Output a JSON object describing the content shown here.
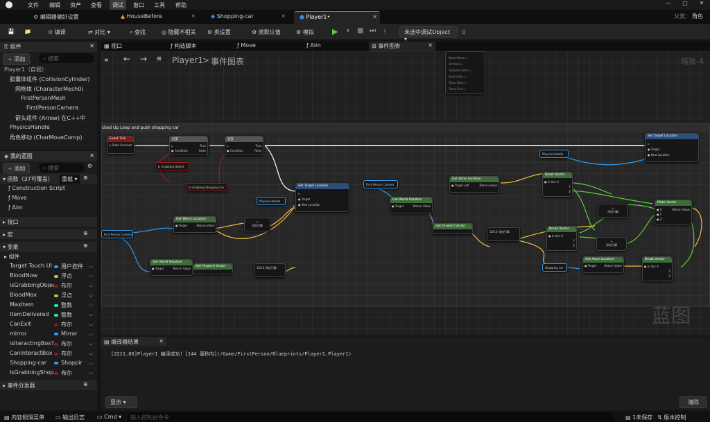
{
  "menu": [
    "文件",
    "编辑",
    "资产",
    "查看",
    "调试",
    "窗口",
    "工具",
    "帮助"
  ],
  "tabs": [
    {
      "label": "编辑器偏好设置",
      "active": false
    },
    {
      "label": "HouseBefore",
      "active": false
    },
    {
      "label": "Shopping-car",
      "active": false
    },
    {
      "label": "Player1•",
      "active": true
    }
  ],
  "parent": {
    "label": "父类：",
    "value": "角色"
  },
  "toolbar": {
    "compile": "编译",
    "diff": "对比",
    "find": "查找",
    "hide": "隐藏不相关",
    "class_settings": "类设置",
    "class_defaults": "类默认值",
    "simulate": "模拟",
    "debug_object": "未选中调试Object"
  },
  "components": {
    "title": "组件",
    "add": "添加",
    "search_placeholder": "搜索",
    "items": [
      {
        "label": "Player1（自我）",
        "indent": 0
      },
      {
        "label": "胶囊体组件 (CollisionCylinder)",
        "indent": 1
      },
      {
        "label": "网格体 (CharacterMesh0)",
        "indent": 2
      },
      {
        "label": "FirstPersonMesh",
        "indent": 3
      },
      {
        "label": "FirstPersonCamera",
        "indent": 4
      },
      {
        "label": "箭头组件 (Arrow)  在C++中",
        "indent": 2
      },
      {
        "label": "PhysicsHandle",
        "indent": 1
      },
      {
        "label": "角色移动 (CharMoveComp)",
        "indent": 1
      }
    ]
  },
  "mybp": {
    "title": "我的蓝图",
    "add": "添加",
    "search_placeholder": "搜索",
    "functions_label": "函数（37可覆盖）",
    "override": "重载",
    "functions": [
      "Construction Script",
      "Move",
      "Aim"
    ],
    "interfaces": "接口",
    "macros": "宏",
    "variables": "变量",
    "components": "组件",
    "dispatchers": "事件分发器",
    "vars": [
      {
        "name": "Target Touch UI",
        "type": "用户控件",
        "color": "#2d9bf0"
      },
      {
        "name": "BloodNow",
        "type": "浮点",
        "color": "#9ecf3c"
      },
      {
        "name": "isGrabbingObject",
        "type": "布尔",
        "color": "#8f1a1a"
      },
      {
        "name": "BloodMax",
        "type": "浮点",
        "color": "#9ecf3c"
      },
      {
        "name": "MaxItem",
        "type": "整数",
        "color": "#2de0b0"
      },
      {
        "name": "ItemDelivered",
        "type": "整数",
        "color": "#2de0b0"
      },
      {
        "name": "CanExit",
        "type": "布尔",
        "color": "#8f1a1a"
      },
      {
        "name": "mirror",
        "type": "Mirror",
        "color": "#2d9bf0"
      },
      {
        "name": "isIteractingBox?",
        "type": "布尔",
        "color": "#8f1a1a"
      },
      {
        "name": "CanInteractBox",
        "type": "布尔",
        "color": "#8f1a1a"
      },
      {
        "name": "Shopping-car",
        "type": "Shoppir",
        "color": "#2d9bf0"
      },
      {
        "name": "IsGrabbingShopp",
        "type": "布尔",
        "color": "#8f1a1a"
      }
    ]
  },
  "editor_tabs": [
    "视口",
    "构造脚本",
    "Move",
    "Aim",
    "事件图表"
  ],
  "breadcrumb": {
    "root": "Player1",
    "sep": ">",
    "current": "事件图表",
    "zoom": "缩放-4"
  },
  "comment": "cked Up Loop and push shopping car",
  "watermark": "蓝图",
  "nodes": {
    "tick": "Event Tick",
    "branch": "分支",
    "set_loc": "Set Target Location",
    "phys": "Physics Handle",
    "grab": "Is Grabbing Object",
    "grab_car": "Is Grabbing Shopping Car",
    "fpc": "First Person Camera",
    "get_wl": "Get World Location",
    "get_wr": "Get World Rotation",
    "get_fv": "Get Forward Vector",
    "get_al": "Get Actor Location",
    "break": "Break Vector",
    "make": "Make Vector",
    "shop": "Shopping car",
    "add": "添加引脚",
    "target": "Target",
    "ret": "Return Value",
    "inrot": "In Rot",
    "invec": "In Vec",
    "cond": "Condition",
    "true": "True",
    "false": "False",
    "delta": "Delta Seconds",
    "newloc": "New Location",
    "num": "150.0",
    "self": "self"
  },
  "compiler": {
    "title": "编译器结果",
    "log": "[2211.86]Player1 编译成功！[144 毫秒内](/Game/FirstPerson/Blueprints/Player1.Player1)",
    "show": "显示",
    "clear": "清除"
  },
  "statusbar": {
    "drawer": "内容侧滑菜单",
    "log": "输出日志",
    "cmd": "Cmd",
    "cmd_placeholder": "输入控制台命令",
    "unsaved": "1未保存",
    "version": "版本控制"
  }
}
